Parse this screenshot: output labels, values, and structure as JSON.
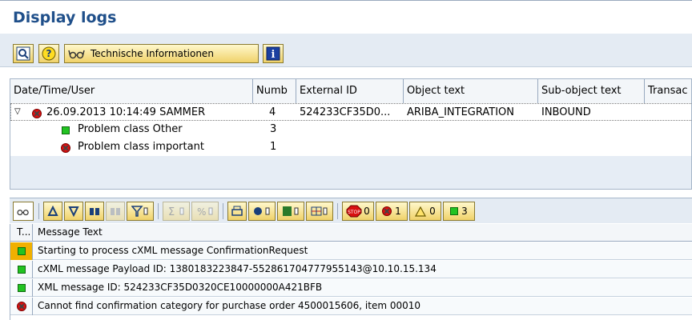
{
  "page": {
    "title": "Display logs"
  },
  "toolbar": {
    "tech_info_label": "Technische Informationen"
  },
  "tree": {
    "columns": [
      "Date/Time/User",
      "Numb",
      "External ID",
      "Object text",
      "Sub-object text",
      "Transac"
    ],
    "main_row": {
      "datetime_user": "26.09.2013  10:14:49  SAMMER",
      "number": "4",
      "external_id": "524233CF35D0...",
      "object_text": "ARIBA_INTEGRATION",
      "sub_object_text": "INBOUND"
    },
    "children": [
      {
        "label": "Problem class Other",
        "number": "3",
        "icon": "green-square"
      },
      {
        "label": "Problem class important",
        "number": "1",
        "icon": "red-stop"
      }
    ]
  },
  "toolbar2": {
    "stop_count": "0",
    "error_count": "1",
    "warning_count": "0",
    "success_count": "3"
  },
  "messages": {
    "header_type": "T...",
    "header_text": "Message Text",
    "rows": [
      {
        "icon": "yellow-green",
        "text": "Starting to process cXML message ConfirmationRequest"
      },
      {
        "icon": "green",
        "text": "cXML message Payload ID: 1380183223847-552861704777955143@10.10.15.134"
      },
      {
        "icon": "green",
        "text": "XML message ID: 524233CF35D0320CE10000000A421BFB"
      },
      {
        "icon": "red",
        "text": "Cannot find confirmation category for purchase order 4500015606, item 00010"
      }
    ]
  },
  "colors": {
    "title": "#1f4f8a",
    "panel_bg": "#e4ebf3",
    "button_bg": "#f0d26a"
  }
}
